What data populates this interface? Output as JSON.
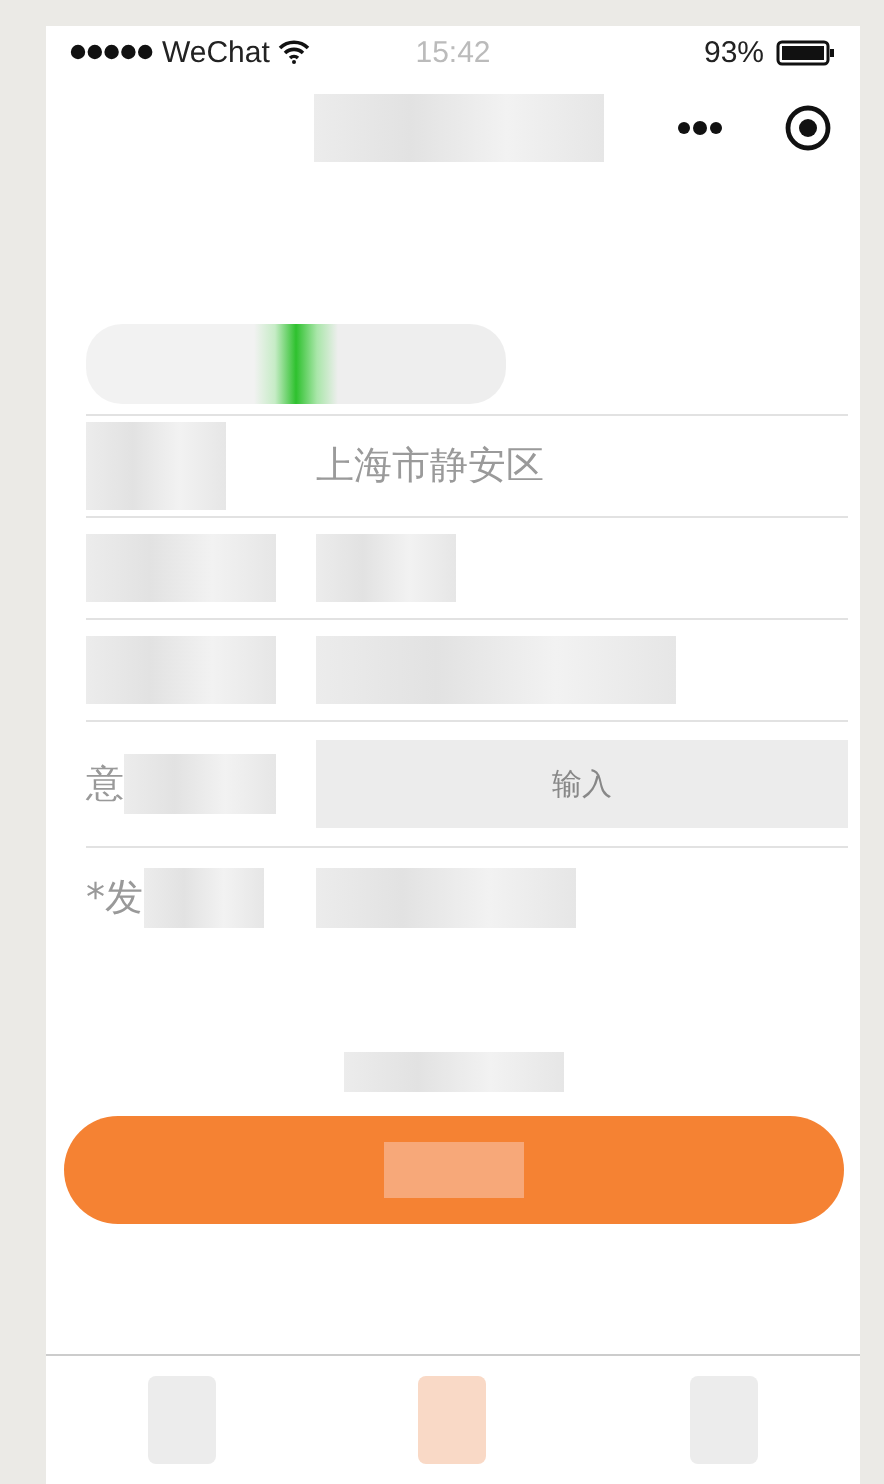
{
  "status_bar": {
    "carrier": "WeChat",
    "time": "15:42",
    "battery": "93%"
  },
  "form": {
    "rows": [
      {
        "kind": "switch"
      },
      {
        "kind": "text",
        "value": "上海市静安区"
      },
      {
        "kind": "blank"
      },
      {
        "kind": "blank"
      },
      {
        "kind": "input",
        "label": "意",
        "placeholder": "输入"
      },
      {
        "kind": "label",
        "label": "*发"
      }
    ]
  }
}
